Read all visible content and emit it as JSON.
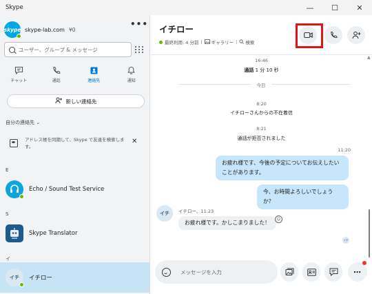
{
  "window": {
    "title": "Skype",
    "minimize": "—",
    "maximize": "☐",
    "close": "✕"
  },
  "sidebar": {
    "profile": {
      "avatar_text": "skype",
      "name": "skype-lab.com",
      "credit": "¥0",
      "more": "•••"
    },
    "search": {
      "placeholder": "ユーザー、グループ & メッセージ"
    },
    "tabs": [
      {
        "label": "チャット",
        "icon": "chat-icon"
      },
      {
        "label": "通話",
        "icon": "phone-icon"
      },
      {
        "label": "連絡先",
        "icon": "contacts-icon",
        "active": true
      },
      {
        "label": "通知",
        "icon": "bell-icon"
      }
    ],
    "new_contact_label": "新しい連絡先",
    "my_contacts_label": "自分の連絡先",
    "my_contacts_chevron": "⌄",
    "sync_text": "アドレス帳を同期して、Skype で友達を検索します。",
    "sync_close": "✕",
    "groups": [
      {
        "letter": "E",
        "contact": "Echo / Sound Test Service"
      },
      {
        "letter": "S",
        "contact": "Skype Translator"
      },
      {
        "letter": "イ",
        "contact": "イチロー",
        "avatar_text": "イチ",
        "selected": true
      }
    ]
  },
  "chat": {
    "title": "イチロー",
    "last_seen": "最終利用: 4 分前",
    "gallery": "ギャラリー",
    "search": "検索",
    "events": [
      {
        "time": "16:46",
        "text": "通話",
        "detail": " 1 分 10 秒"
      },
      {
        "divider": "今日"
      },
      {
        "time": "8:20",
        "text": "イチローさんからの不在着信"
      },
      {
        "time": "8:21",
        "text": "通話が拒否されました"
      }
    ],
    "outgoing_time": "11:20",
    "outgoing": [
      "お疲れ様です、今後の予定についてお伝えしたいことがあります。",
      "今、お時間よろしいでしょうか？"
    ],
    "incoming_sender": "イチロー、11:23",
    "incoming_avatar": "イチ",
    "incoming": "お疲れ様です。かしこまりました！",
    "read_receipt": "イチ",
    "composer_placeholder": "メッセージを入力"
  },
  "colors": {
    "accent": "#0078d4",
    "highlight": "#e0131a",
    "online": "#6bb700",
    "bubble_out": "#c7e6fb",
    "selected_row": "#c7e4f7"
  }
}
